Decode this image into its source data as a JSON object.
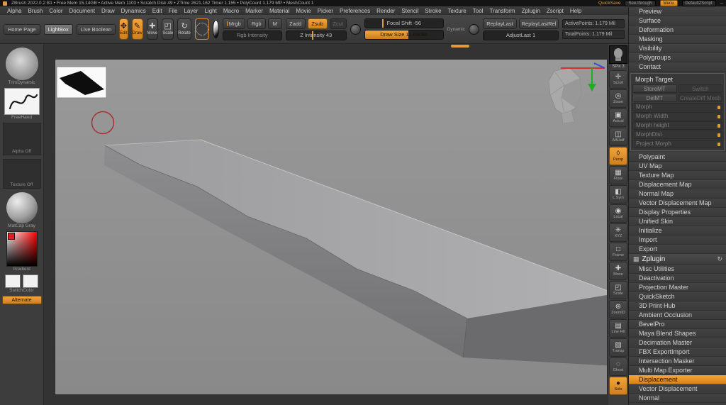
{
  "titlebar": {
    "status": "ZBrush 2022.0.2  B1  •  Free Mem 15.14GB  •  Active Mem 1103  •  Scratch Disk 49  •  ZTime 2621.162  Timer 1.155  •  PolyCount 1.179 MP  •  MeshCount 1",
    "quicksave": "QuickSave",
    "see_through": "See-through",
    "menu": "Menu",
    "default_zscript": "DefaultZScript",
    "minimize": "–"
  },
  "menubar": {
    "items": [
      "Alpha",
      "Brush",
      "Color",
      "Document",
      "Draw",
      "Dynamics",
      "Edit",
      "File",
      "Layer",
      "Light",
      "Macro",
      "Marker",
      "Material",
      "Movie",
      "Picker",
      "Preferences",
      "Render",
      "Stencil",
      "Stroke",
      "Texture",
      "Tool",
      "Transform",
      "Zplugin",
      "Zscript",
      "Help"
    ]
  },
  "shelf": {
    "home_page": "Home Page",
    "lightbox": "LightBox",
    "live_boolean": "Live Boolean",
    "edit": "Edit",
    "draw": "Draw",
    "move": "Move",
    "scale": "Scale",
    "rotate": "Rotate",
    "mrgb": "Mrgb",
    "rgb": "Rgb",
    "m": "M",
    "rgb_intensity": "Rgb Intensity",
    "zadd": "Zadd",
    "zsub": "Zsub",
    "zcut": "Zcut",
    "z_intensity": "Z Intensity 43",
    "focal_shift": "Focal Shift -56",
    "draw_size": "Draw Size 11.69084",
    "dynamic": "Dynamic",
    "replay_last": "ReplayLast",
    "replay_last_rel": "ReplayLastRel",
    "adjust_last": "AdjustLast 1",
    "active_points": "ActivePoints: 1.179 Mil",
    "total_points": "TotalPoints: 1.179 Mil"
  },
  "left_tray": {
    "brush_label": "TrimDynamic",
    "stroke_label": "FreeHand",
    "alpha_label": "Alpha Off",
    "texture_label": "Texture Off",
    "material_label": "MatCap Gray",
    "gradient_label": "Gradient",
    "switch_label": "SwitchColor",
    "alternate_label": "Alternate"
  },
  "right_shelf": {
    "spix": "SPix 3",
    "items": [
      {
        "label": "Scroll",
        "glyph": "✛"
      },
      {
        "label": "Zoom",
        "glyph": "◎"
      },
      {
        "label": "Actual",
        "glyph": "▣"
      },
      {
        "label": "AAHalf",
        "glyph": "◫"
      },
      {
        "label": "Persp",
        "glyph": "◊"
      },
      {
        "label": "Floor",
        "glyph": "▦"
      },
      {
        "label": "L.Sym",
        "glyph": "◧"
      },
      {
        "label": "Local",
        "glyph": "◉"
      },
      {
        "label": "XYZ",
        "glyph": "✳"
      },
      {
        "label": "Frame",
        "glyph": "□"
      },
      {
        "label": "Move",
        "glyph": "✚"
      },
      {
        "label": "Scale",
        "glyph": "◰"
      },
      {
        "label": "ZoomID",
        "glyph": "⊕"
      },
      {
        "label": "Line Fill",
        "glyph": "▤"
      },
      {
        "label": "Transp",
        "glyph": "▨"
      },
      {
        "label": "Ghost",
        "glyph": "◌"
      },
      {
        "label": "Solo",
        "glyph": "●"
      }
    ]
  },
  "right_panel": {
    "top_items": [
      "Preview",
      "Surface",
      "Deformation",
      "Masking",
      "Visibility",
      "Polygroups",
      "Contact"
    ],
    "morph_target": {
      "title": "Morph Target",
      "store_mt": "StoreMT",
      "switch": "Switch",
      "del_mt": "DelMT",
      "create_diff": "CreateDiff Mesh",
      "sliders": [
        "Morph",
        "Morph Width",
        "Morph height",
        "MorphDist",
        "Project Morph"
      ]
    },
    "map_items": [
      "Polypaint",
      "UV Map",
      "Texture Map",
      "Displacement Map",
      "Normal Map",
      "Vector Displacement Map",
      "Display Properties",
      "Unified Skin",
      "Initialize",
      "Import",
      "Export"
    ],
    "zplugin": {
      "title": "Zplugin",
      "items": [
        "Misc Utilities",
        "Deactivation",
        "Projection Master",
        "QuickSketch",
        "3D Print Hub",
        "Ambient Occlusion",
        "BevelPro",
        "Maya Blend Shapes",
        "Decimation Master",
        "FBX ExportImport",
        "Intersection Masker",
        "Multi Map Exporter",
        "Displacement",
        "Vector Displacement",
        "Normal"
      ]
    }
  },
  "colors": {
    "accent": "#e29b3a",
    "canvas_bg": "#8f8f8f"
  }
}
